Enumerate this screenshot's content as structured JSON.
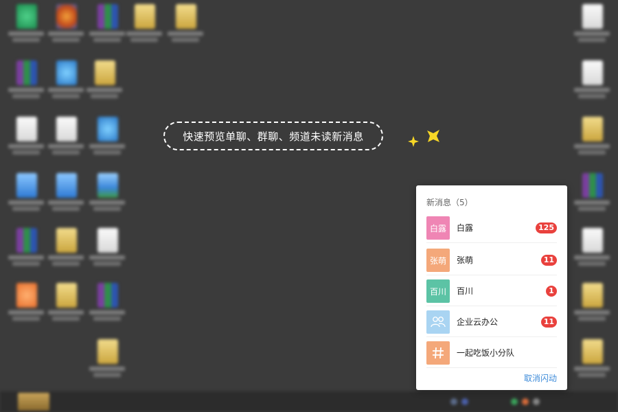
{
  "callout": {
    "text": "快速预览单聊、群聊、频道未读新消息"
  },
  "popup": {
    "header": "新消息（5）",
    "items": [
      {
        "avatar_text": "白露",
        "name": "白露",
        "badge": "125",
        "avatar_color": "#ef85b4"
      },
      {
        "avatar_text": "张萌",
        "name": "张萌",
        "badge": "11",
        "avatar_color": "#f4a87a"
      },
      {
        "avatar_text": "百川",
        "name": "百川",
        "badge": "1",
        "avatar_color": "#5cc3a5"
      },
      {
        "avatar_icon": "group-icon",
        "name": "企业云办公",
        "badge": "11",
        "avatar_color": "#a9d4f2"
      },
      {
        "avatar_icon": "hash-icon",
        "name": "一起吃饭小分队",
        "avatar_color": "#f4a87a"
      }
    ],
    "cancel_label": "取消闪动"
  },
  "colors": {
    "badge": "#e9413d",
    "link": "#3d8bd9",
    "sparkle": "#f7d726",
    "desktop": "#3b3b3b"
  }
}
